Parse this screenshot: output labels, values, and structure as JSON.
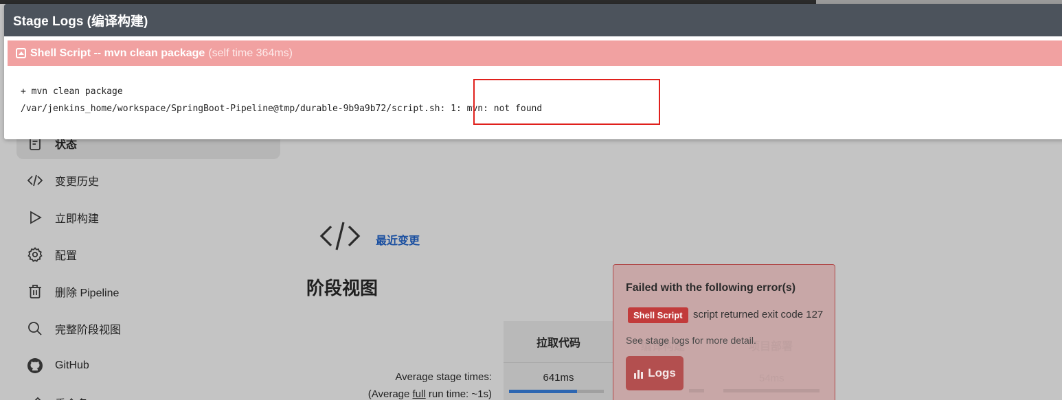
{
  "modal": {
    "title": "Stage Logs (编译构建)",
    "section": {
      "title": "Shell Script -- mvn clean package",
      "self_time": "(self time 364ms)"
    },
    "log_lines": [
      "+ mvn clean package",
      "/var/jenkins_home/workspace/SpringBoot-Pipeline@tmp/durable-9b9a9b72/script.sh: 1: mvn: not found"
    ]
  },
  "sidebar": {
    "items": [
      {
        "label": "状态",
        "icon": "status-icon"
      },
      {
        "label": "变更历史",
        "icon": "code-icon"
      },
      {
        "label": "立即构建",
        "icon": "play-icon"
      },
      {
        "label": "配置",
        "icon": "gear-icon"
      },
      {
        "label": "删除 Pipeline",
        "icon": "trash-icon"
      },
      {
        "label": "完整阶段视图",
        "icon": "search-icon"
      },
      {
        "label": "GitHub",
        "icon": "github-icon"
      },
      {
        "label": "重命名",
        "icon": "pencil-icon"
      }
    ]
  },
  "main": {
    "recent_changes": "最近变更",
    "stage_view_title": "阶段视图",
    "average_stage_times": "Average stage times:",
    "average_run_time_prefix": "(Average ",
    "average_run_time_link": "full",
    "average_run_time_suffix": " run time: ~1s)",
    "stages": [
      {
        "name": "拉取代码",
        "time": "641ms",
        "progress": 0.72
      },
      {
        "name": "编译构建",
        "time": ""
      },
      {
        "name": "项目部署",
        "time": "54ms"
      }
    ]
  },
  "error_popover": {
    "title": "Failed with the following error(s)",
    "badge": "Shell Script",
    "message": "script returned exit code 127",
    "see_logs": "See stage logs for more detail.",
    "logs_button": "Logs"
  },
  "colors": {
    "modal_header": "#4c535c",
    "failed_section": "#f1a1a1",
    "highlight_border": "#e0201c",
    "link": "#1a4fa0",
    "error_badge": "#c23b3b"
  }
}
